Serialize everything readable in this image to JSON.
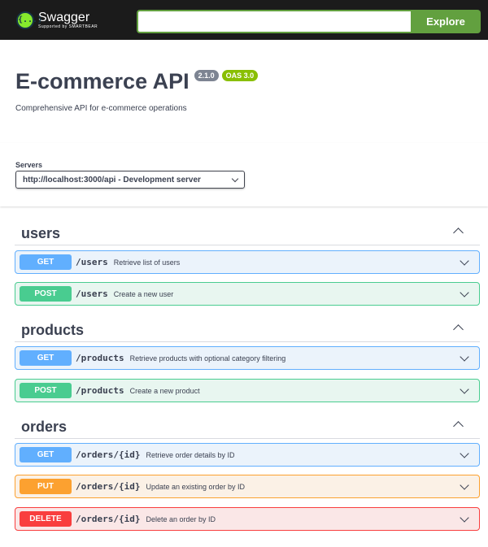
{
  "topbar": {
    "logo_title": "Swagger",
    "logo_subtitle": "Supported by SMARTBEAR",
    "logo_glyph": "{...}",
    "url_value": "",
    "explore_label": "Explore"
  },
  "info": {
    "title": "E-commerce API",
    "version": "2.1.0",
    "oas": "OAS 3.0",
    "description": "Comprehensive API for e-commerce operations"
  },
  "servers": {
    "label": "Servers",
    "selected": "http://localhost:3000/api - Development server"
  },
  "tags": [
    {
      "name": "users",
      "operations": [
        {
          "method": "GET",
          "path": "/users",
          "summary": "Retrieve list of users"
        },
        {
          "method": "POST",
          "path": "/users",
          "summary": "Create a new user"
        }
      ]
    },
    {
      "name": "products",
      "operations": [
        {
          "method": "GET",
          "path": "/products",
          "summary": "Retrieve products with optional category filtering"
        },
        {
          "method": "POST",
          "path": "/products",
          "summary": "Create a new product"
        }
      ]
    },
    {
      "name": "orders",
      "operations": [
        {
          "method": "GET",
          "path": "/orders/{id}",
          "summary": "Retrieve order details by ID"
        },
        {
          "method": "PUT",
          "path": "/orders/{id}",
          "summary": "Update an existing order by ID"
        },
        {
          "method": "DELETE",
          "path": "/orders/{id}",
          "summary": "Delete an order by ID"
        }
      ]
    }
  ],
  "colors": {
    "get": "#61affe",
    "post": "#49cc90",
    "put": "#fca130",
    "delete": "#f93e3e",
    "brand": "#62a03f"
  }
}
